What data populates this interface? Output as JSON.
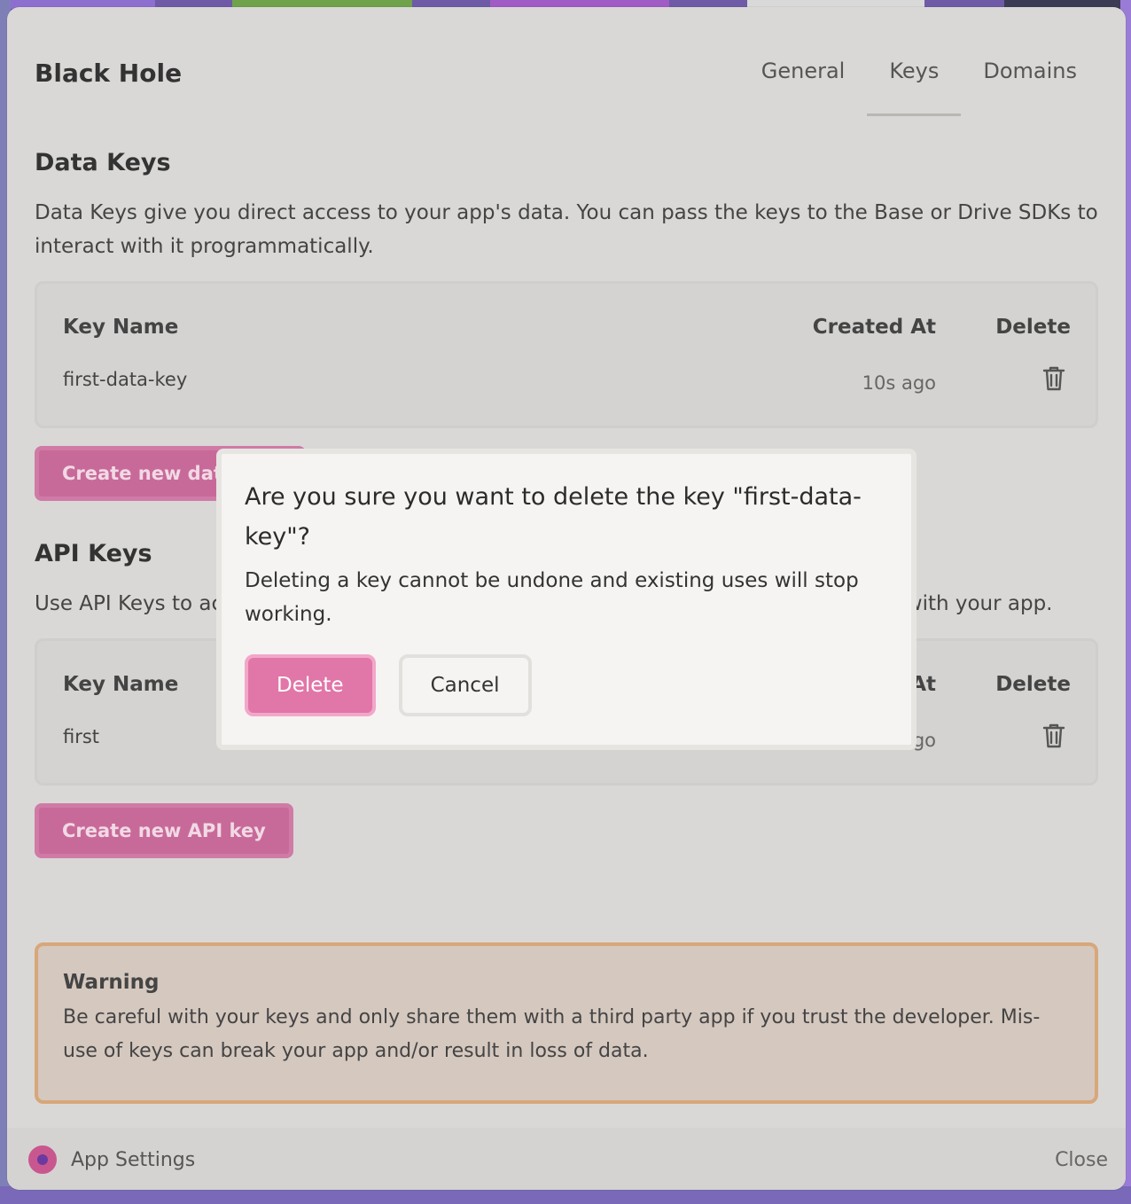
{
  "app": {
    "name": "Black Hole"
  },
  "tabs": [
    {
      "label": "General"
    },
    {
      "label": "Keys"
    },
    {
      "label": "Domains"
    }
  ],
  "data_keys": {
    "title": "Data Keys",
    "description": "Data Keys give you direct access to your app's data. You can pass the keys to the Base or Drive SDKs to interact with it programmatically.",
    "columns": {
      "name": "Key Name",
      "created": "Created At",
      "delete": "Delete"
    },
    "rows": [
      {
        "name": "first-data-key",
        "created": "10s ago"
      }
    ],
    "create_button": "Create new data key"
  },
  "api_keys": {
    "title": "API Keys",
    "description": "Use API Keys to access your app's HTTP endpoints programmatically. They only work with your app.",
    "columns": {
      "name": "Key Name",
      "created": "Created At",
      "delete": "Delete"
    },
    "rows": [
      {
        "name": "first",
        "created": "20s ago"
      }
    ],
    "create_button": "Create new API key"
  },
  "warning": {
    "title": "Warning",
    "text": "Be careful with your keys and only share them with a third party app if you trust the developer. Mis-use of keys can break your app and/or result in loss of data."
  },
  "footer": {
    "label": "App Settings",
    "close": "Close"
  },
  "modal": {
    "title": "Are you sure you want to delete the key \"first-data-key\"?",
    "text": "Deleting a key cannot be undone and existing uses will stop working.",
    "delete_label": "Delete",
    "cancel_label": "Cancel"
  },
  "icons": {
    "delete": "trash-icon",
    "app": "app-logo-icon"
  },
  "colors": {
    "accent": "#e176a8",
    "warning_border": "#d7a77a",
    "warning_bg": "#d5c8bf"
  }
}
